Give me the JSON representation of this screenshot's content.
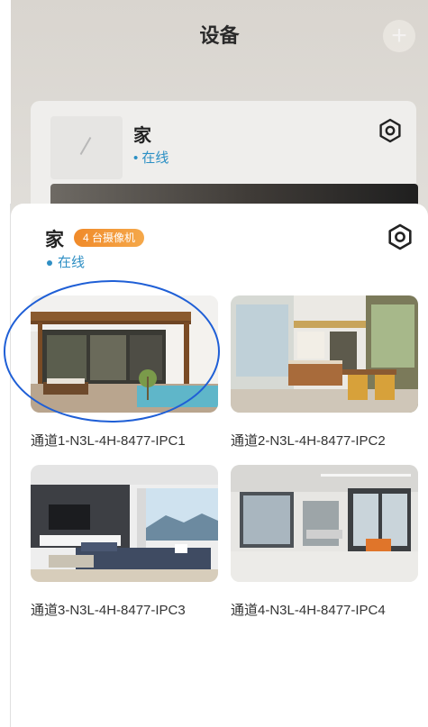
{
  "background": {
    "title": "设备",
    "card": {
      "name": "家",
      "status": "• 在线"
    }
  },
  "sheet": {
    "home_name": "家",
    "badge": "4 台摄像机",
    "status": "在线"
  },
  "cameras": [
    {
      "label": "通道1-N3L-4H-8477-IPC1"
    },
    {
      "label": "通道2-N3L-4H-8477-IPC2"
    },
    {
      "label": "通道3-N3L-4H-8477-IPC3"
    },
    {
      "label": "通道4-N3L-4H-8477-IPC4"
    }
  ],
  "colors": {
    "accent_blue": "#2f8fc4",
    "badge_orange": "#f08a2a",
    "highlight": "#1f5fd6"
  }
}
